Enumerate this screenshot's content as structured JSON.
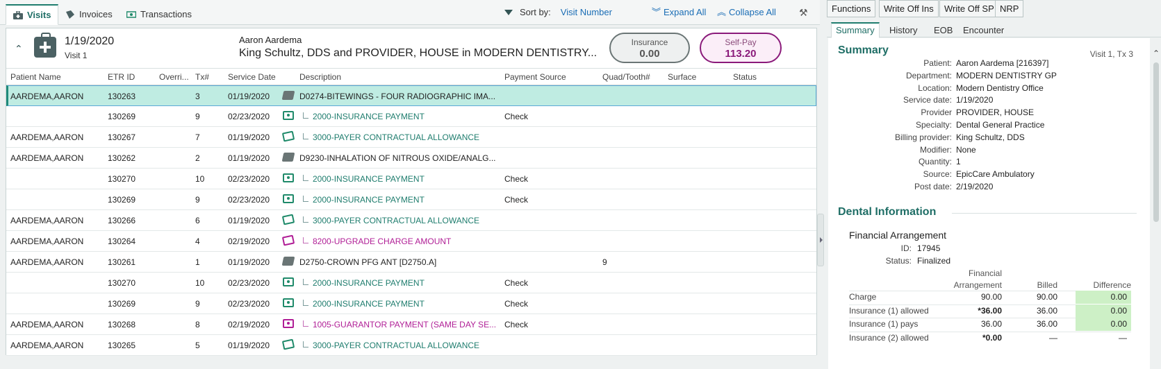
{
  "left_tabs": {
    "visits": "Visits",
    "invoices": "Invoices",
    "transactions": "Transactions"
  },
  "sortbar": {
    "sort_label": "Sort by:",
    "sort_value": "Visit Number",
    "expand_all": "Expand All",
    "collapse_all": "Collapse All"
  },
  "visit": {
    "date": "1/19/2020",
    "number": "Visit 1",
    "patient": "Aaron Aardema",
    "provider_line": "King Schultz, DDS and PROVIDER, HOUSE in MODERN DENTISTRY...",
    "insurance_label": "Insurance",
    "insurance_value": "0.00",
    "selfpay_label": "Self-Pay",
    "selfpay_value": "113.20"
  },
  "columns": [
    "Patient Name",
    "ETR ID",
    "Overri...",
    "Tx#",
    "Service Date",
    "Description",
    "Payment Source",
    "Quad/Tooth#",
    "Surface",
    "Status"
  ],
  "rows": [
    {
      "patient": "AARDEMA,AARON",
      "etr": "130263",
      "tx": "3",
      "date": "01/19/2020",
      "icon": "procedure-icon",
      "type": "proc",
      "desc": "D0274-BITEWINGS - FOUR RADIOGRAPHIC IMA...",
      "source": "",
      "quad": ""
    },
    {
      "patient": "",
      "etr": "130269",
      "tx": "9",
      "date": "02/23/2020",
      "icon": "insurance-payment-icon",
      "type": "ins",
      "desc": "2000-INSURANCE PAYMENT",
      "source": "Check",
      "quad": ""
    },
    {
      "patient": "AARDEMA,AARON",
      "etr": "130267",
      "tx": "7",
      "date": "01/19/2020",
      "icon": "adjustment-icon",
      "type": "adj",
      "desc": "3000-PAYER CONTRACTUAL ALLOWANCE",
      "source": "",
      "quad": ""
    },
    {
      "patient": "AARDEMA,AARON",
      "etr": "130262",
      "tx": "2",
      "date": "01/19/2020",
      "icon": "procedure-icon",
      "type": "proc",
      "desc": "D9230-INHALATION OF NITROUS OXIDE/ANALG...",
      "source": "",
      "quad": ""
    },
    {
      "patient": "",
      "etr": "130270",
      "tx": "10",
      "date": "02/23/2020",
      "icon": "insurance-payment-icon",
      "type": "ins",
      "desc": "2000-INSURANCE PAYMENT",
      "source": "Check",
      "quad": ""
    },
    {
      "patient": "",
      "etr": "130269",
      "tx": "9",
      "date": "02/23/2020",
      "icon": "insurance-payment-icon",
      "type": "ins",
      "desc": "2000-INSURANCE PAYMENT",
      "source": "Check",
      "quad": ""
    },
    {
      "patient": "AARDEMA,AARON",
      "etr": "130266",
      "tx": "6",
      "date": "01/19/2020",
      "icon": "adjustment-icon",
      "type": "adj",
      "desc": "3000-PAYER CONTRACTUAL ALLOWANCE",
      "source": "",
      "quad": ""
    },
    {
      "patient": "AARDEMA,AARON",
      "etr": "130264",
      "tx": "4",
      "date": "02/19/2020",
      "icon": "upgrade-charge-icon",
      "type": "up",
      "desc": "8200-UPGRADE CHARGE AMOUNT",
      "source": "",
      "quad": ""
    },
    {
      "patient": "AARDEMA,AARON",
      "etr": "130261",
      "tx": "1",
      "date": "01/19/2020",
      "icon": "procedure-icon",
      "type": "proc",
      "desc": "D2750-CROWN PFG ANT [D2750.A]",
      "source": "",
      "quad": "9"
    },
    {
      "patient": "",
      "etr": "130270",
      "tx": "10",
      "date": "02/23/2020",
      "icon": "insurance-payment-icon",
      "type": "ins",
      "desc": "2000-INSURANCE PAYMENT",
      "source": "Check",
      "quad": ""
    },
    {
      "patient": "",
      "etr": "130269",
      "tx": "9",
      "date": "02/23/2020",
      "icon": "insurance-payment-icon",
      "type": "ins",
      "desc": "2000-INSURANCE PAYMENT",
      "source": "Check",
      "quad": ""
    },
    {
      "patient": "AARDEMA,AARON",
      "etr": "130268",
      "tx": "8",
      "date": "02/19/2020",
      "icon": "guarantor-payment-icon",
      "type": "gp",
      "desc": "1005-GUARANTOR PAYMENT (SAME DAY SE...",
      "source": "Check",
      "quad": ""
    },
    {
      "patient": "AARDEMA,AARON",
      "etr": "130265",
      "tx": "5",
      "date": "01/19/2020",
      "icon": "adjustment-icon",
      "type": "adj",
      "desc": "3000-PAYER CONTRACTUAL ALLOWANCE",
      "source": "",
      "quad": ""
    }
  ],
  "right_buttons": [
    "Functions",
    "Write Off Ins",
    "Write Off SP",
    "NRP"
  ],
  "right_tabs": [
    "Summary",
    "History",
    "EOB",
    "Encounter"
  ],
  "summary": {
    "title": "Summary",
    "visit_tx": "Visit 1, Tx 3",
    "fields": [
      {
        "k": "Patient:",
        "v": "Aaron Aardema [216397]"
      },
      {
        "k": "Department:",
        "v": "MODERN DENTISTRY GP"
      },
      {
        "k": "Location:",
        "v": "Modern Dentistry Office"
      },
      {
        "k": "Service date:",
        "v": "1/19/2020"
      },
      {
        "k": "Provider",
        "v": "PROVIDER, HOUSE"
      },
      {
        "k": "Specialty:",
        "v": "Dental General Practice"
      },
      {
        "k": "Billing provider:",
        "v": "King Schultz, DDS"
      },
      {
        "k": "Modifier:",
        "v": "None"
      },
      {
        "k": "Quantity:",
        "v": "1"
      },
      {
        "k": "Source:",
        "v": "EpicCare Ambulatory"
      },
      {
        "k": "Post date:",
        "v": "2/19/2020"
      }
    ]
  },
  "dental": {
    "title": "Dental Information",
    "fa_title": "Financial Arrangement",
    "id_label": "ID:",
    "id_value": "17945",
    "status_label": "Status:",
    "status_value": "Finalized",
    "col_fa_line1": "Financial",
    "col_fa_line2": "Arrangement",
    "col_billed": "Billed",
    "col_diff": "Difference",
    "rows": [
      {
        "label": "Charge",
        "fa": "90.00",
        "billed": "90.00",
        "diff": "0.00"
      },
      {
        "label": "Insurance (1) allowed",
        "fa": "*36.00",
        "billed": "36.00",
        "diff": "0.00"
      },
      {
        "label": "Insurance (1) pays",
        "fa": "36.00",
        "billed": "36.00",
        "diff": "0.00"
      },
      {
        "label": "Insurance (2) allowed",
        "fa": "*0.00",
        "billed": "—",
        "diff": "—"
      }
    ]
  }
}
